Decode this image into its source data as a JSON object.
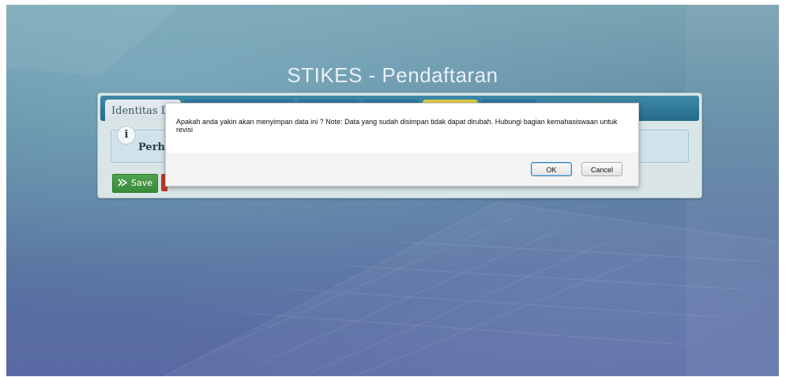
{
  "app": {
    "title": "STIKES - Pendaftaran"
  },
  "tabs": [
    {
      "label": "Identitas Diri",
      "state": "active"
    },
    {
      "label": "",
      "state": "normal"
    },
    {
      "label": "",
      "state": "normal"
    },
    {
      "label": "",
      "state": "normal"
    },
    {
      "label": "",
      "state": "highlight"
    },
    {
      "label": "",
      "state": "normal"
    }
  ],
  "info": {
    "icon": "info-icon",
    "icon_glyph": "i",
    "text": "Perhatian"
  },
  "toolbar": {
    "save_label": "Save",
    "save_icon": "save-icon"
  },
  "dialog": {
    "message": "Apakah anda yakin akan menyimpan data ini ? Note: Data yang sudah disimpan tidak dapat dirubah. Hubungi bagian kemahasiswaan untuk revisi",
    "ok_label": "OK",
    "cancel_label": "Cancel"
  },
  "colors": {
    "tabbar": "#246a8b",
    "highlight_tab": "#d4c03a",
    "save_button": "#3a8a3a",
    "dialog_background": "#f3f3f3"
  }
}
